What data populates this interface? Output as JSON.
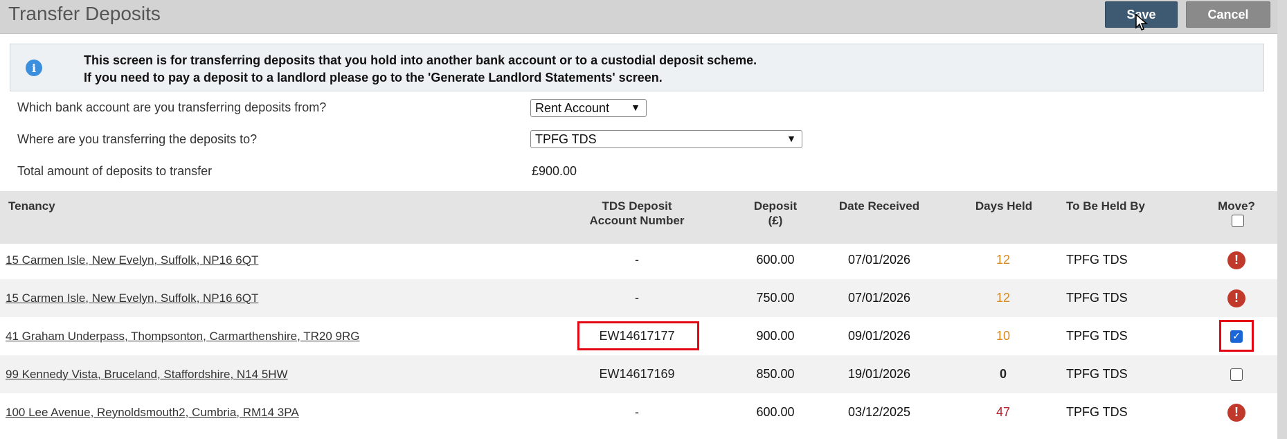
{
  "header": {
    "title": "Transfer Deposits",
    "save_label": "Save",
    "cancel_label": "Cancel"
  },
  "info": {
    "line1": "This screen is for transferring deposits that you hold into another bank account or to a custodial deposit scheme.",
    "line2": "If you need to pay a deposit to a landlord please go to the 'Generate Landlord Statements' screen."
  },
  "form": {
    "from_label": "Which bank account are you transferring deposits from?",
    "from_value": "Rent Account",
    "to_label": "Where are you transferring the deposits to?",
    "to_value": "TPFG TDS",
    "total_label": "Total amount of deposits to transfer",
    "total_value": "£900.00"
  },
  "table": {
    "headers": {
      "tenancy": "Tenancy",
      "account_line1": "TDS Deposit",
      "account_line2": "Account Number",
      "deposit_line1": "Deposit",
      "deposit_line2": "(£)",
      "date": "Date Received",
      "days": "Days Held",
      "held_by": "To Be Held By",
      "move": "Move?"
    },
    "rows": [
      {
        "tenancy": "15 Carmen Isle, New Evelyn, Suffolk, NP16 6QT",
        "account": "-",
        "deposit": "600.00",
        "date": "07/01/2026",
        "days": "12",
        "held_by": "TPFG TDS",
        "move": "warning"
      },
      {
        "tenancy": "15 Carmen Isle, New Evelyn, Suffolk, NP16 6QT",
        "account": "-",
        "deposit": "750.00",
        "date": "07/01/2026",
        "days": "12",
        "held_by": "TPFG TDS",
        "move": "warning"
      },
      {
        "tenancy": "41 Graham Underpass, Thompsonton, Carmarthenshire, TR20 9RG",
        "account": "EW14617177",
        "deposit": "900.00",
        "date": "09/01/2026",
        "days": "10",
        "held_by": "TPFG TDS",
        "move": "checked"
      },
      {
        "tenancy": "99 Kennedy Vista, Bruceland, Staffordshire, N14 5HW",
        "account": "EW14617169",
        "deposit": "850.00",
        "date": "19/01/2026",
        "days": "0",
        "held_by": "TPFG TDS",
        "move": "unchecked"
      },
      {
        "tenancy": "100 Lee Avenue, Reynoldsmouth2, Cumbria, RM14 3PA",
        "account": "-",
        "deposit": "600.00",
        "date": "03/12/2025",
        "days": "47",
        "held_by": "TPFG TDS",
        "move": "warning"
      }
    ]
  },
  "colors": {
    "save": "#3e5a73",
    "cancel": "#8a8a8a",
    "highlight": "#e30613",
    "warning": "#c0392b"
  },
  "icons": {
    "info": "info-icon",
    "warning": "exclamation-circle-icon",
    "cursor": "mouse-pointer-icon"
  }
}
